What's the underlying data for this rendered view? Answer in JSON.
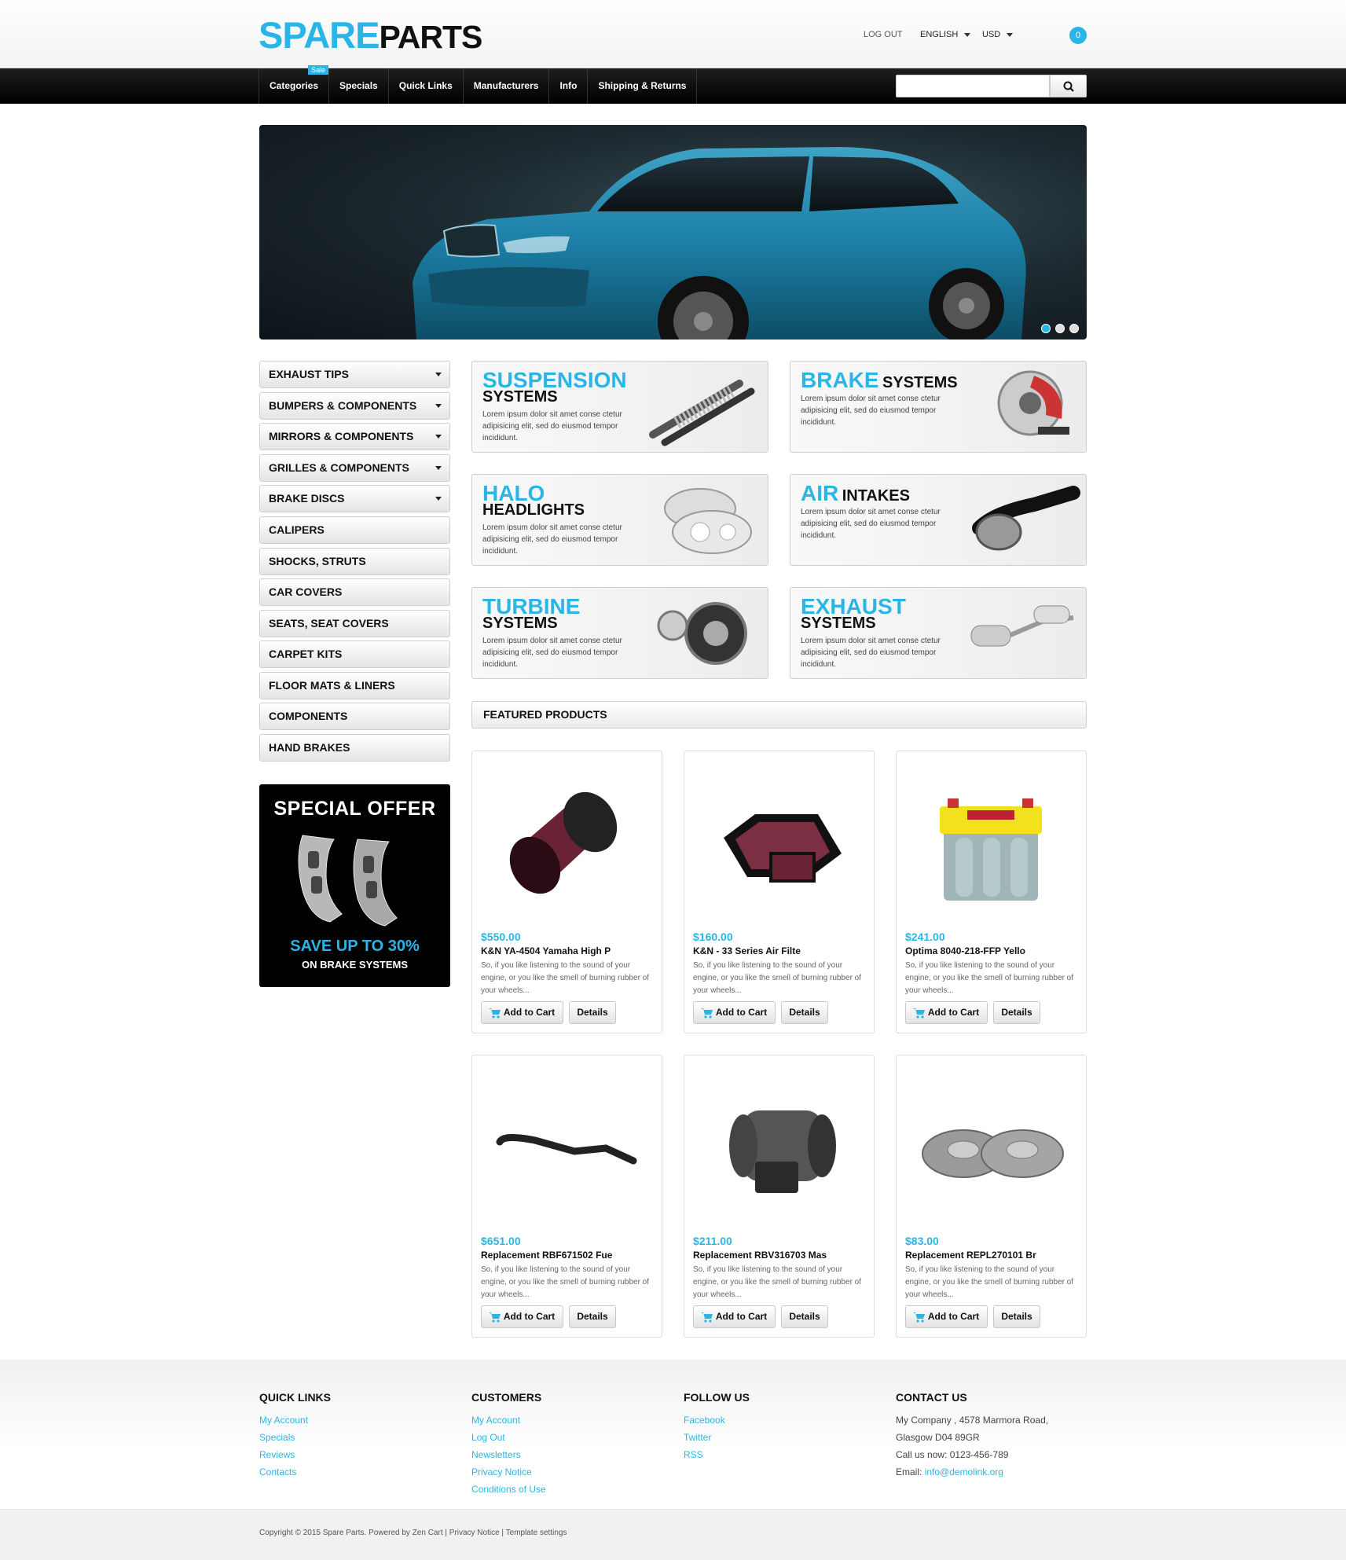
{
  "header": {
    "logo_part1": "SPARE",
    "logo_part2": "PARTS",
    "logout": "LOG OUT",
    "language": "ENGLISH",
    "currency": "USD",
    "cart_count": "0"
  },
  "nav": {
    "items": [
      "Categories",
      "Specials",
      "Quick Links",
      "Manufacturers",
      "Info",
      "Shipping & Returns"
    ],
    "sale_tag": "Sale"
  },
  "search": {
    "placeholder": "",
    "icon": "search-icon"
  },
  "slider": {
    "slide_count": 3,
    "active": 1
  },
  "categories": [
    "EXHAUST TIPS",
    "BUMPERS & COMPONENTS",
    "MIRRORS & COMPONENTS",
    "GRILLES & COMPONENTS",
    "BRAKE DISCS",
    "CALIPERS",
    "SHOCKS, STRUTS",
    "CAR COVERS",
    "SEATS, SEAT COVERS",
    "CARPET KITS",
    "FLOOR MATS & LINERS",
    "COMPONENTS",
    "HAND BRAKES"
  ],
  "special_offer": {
    "title": "SPECIAL OFFER",
    "line1": "SAVE UP TO 30%",
    "line2": "ON BRAKE SYSTEMS"
  },
  "banners": [
    {
      "blue": "SUSPENSION",
      "dark": "SYSTEMS",
      "desc": "Lorem ipsum dolor sit amet conse ctetur adipisicing elit, sed do eiusmod tempor incididunt."
    },
    {
      "blue": "BRAKE",
      "dark": "SYSTEMS",
      "desc": "Lorem ipsum dolor sit amet conse ctetur adipisicing elit, sed do eiusmod tempor incididunt."
    },
    {
      "blue": "HALO",
      "dark": "HEADLIGHTS",
      "desc": "Lorem ipsum dolor sit amet conse ctetur adipisicing elit, sed do eiusmod tempor incididunt."
    },
    {
      "blue": "AIR",
      "dark": "INTAKES",
      "desc": "Lorem ipsum dolor sit amet conse ctetur adipisicing elit, sed do eiusmod tempor incididunt."
    },
    {
      "blue": "TURBINE",
      "dark": "SYSTEMS",
      "desc": "Lorem ipsum dolor sit amet conse ctetur adipisicing elit, sed do eiusmod tempor incididunt."
    },
    {
      "blue": "EXHAUST",
      "dark": "SYSTEMS",
      "desc": "Lorem ipsum dolor sit amet conse ctetur adipisicing elit, sed do eiusmod tempor incididunt."
    }
  ],
  "featured": {
    "title": "FEATURED PRODUCTS",
    "add_label": "Add to Cart",
    "details_label": "Details",
    "products": [
      {
        "price": "$550.00",
        "name": "K&N YA-4504 Yamaha High P",
        "desc": "So, if you like listening to the sound of your engine, or you like the smell of burning rubber of your wheels..."
      },
      {
        "price": "$160.00",
        "name": "K&N - 33 Series Air Filte",
        "desc": "So, if you like listening to the sound of your engine, or you like the smell of burning rubber of your wheels..."
      },
      {
        "price": "$241.00",
        "name": "Optima 8040-218-FFP Yello",
        "desc": "So, if you like listening to the sound of your engine, or you like the smell of burning rubber of your wheels..."
      },
      {
        "price": "$651.00",
        "name": "Replacement RBF671502 Fue",
        "desc": "So, if you like listening to the sound of your engine, or you like the smell of burning rubber of your wheels..."
      },
      {
        "price": "$211.00",
        "name": "Replacement RBV316703 Mas",
        "desc": "So, if you like listening to the sound of your engine, or you like the smell of burning rubber of your wheels..."
      },
      {
        "price": "$83.00",
        "name": "Replacement REPL270101 Br",
        "desc": "So, if you like listening to the sound of your engine, or you like the smell of burning rubber of your wheels..."
      }
    ]
  },
  "footer": {
    "quick_links": {
      "title": "QUICK LINKS",
      "links": [
        "My Account",
        "Specials",
        "Reviews",
        "Contacts"
      ]
    },
    "customers": {
      "title": "CUSTOMERS",
      "links": [
        "My Account",
        "Log Out",
        "Newsletters",
        "Privacy Notice",
        "Conditions of Use"
      ]
    },
    "follow": {
      "title": "FOLLOW US",
      "links": [
        "Facebook",
        "Twitter",
        "RSS"
      ]
    },
    "contact": {
      "title": "CONTACT US",
      "address1": "My Company , 4578 Marmora Road,",
      "address2": "Glasgow D04 89GR",
      "phone": "Call us now: 0123-456-789",
      "email_label": "Email: ",
      "email": "info@demolink.org"
    },
    "copyright": "Copyright © 2015 Spare Parts. Powered by Zen Cart  |  Privacy Notice  |  Template settings"
  }
}
